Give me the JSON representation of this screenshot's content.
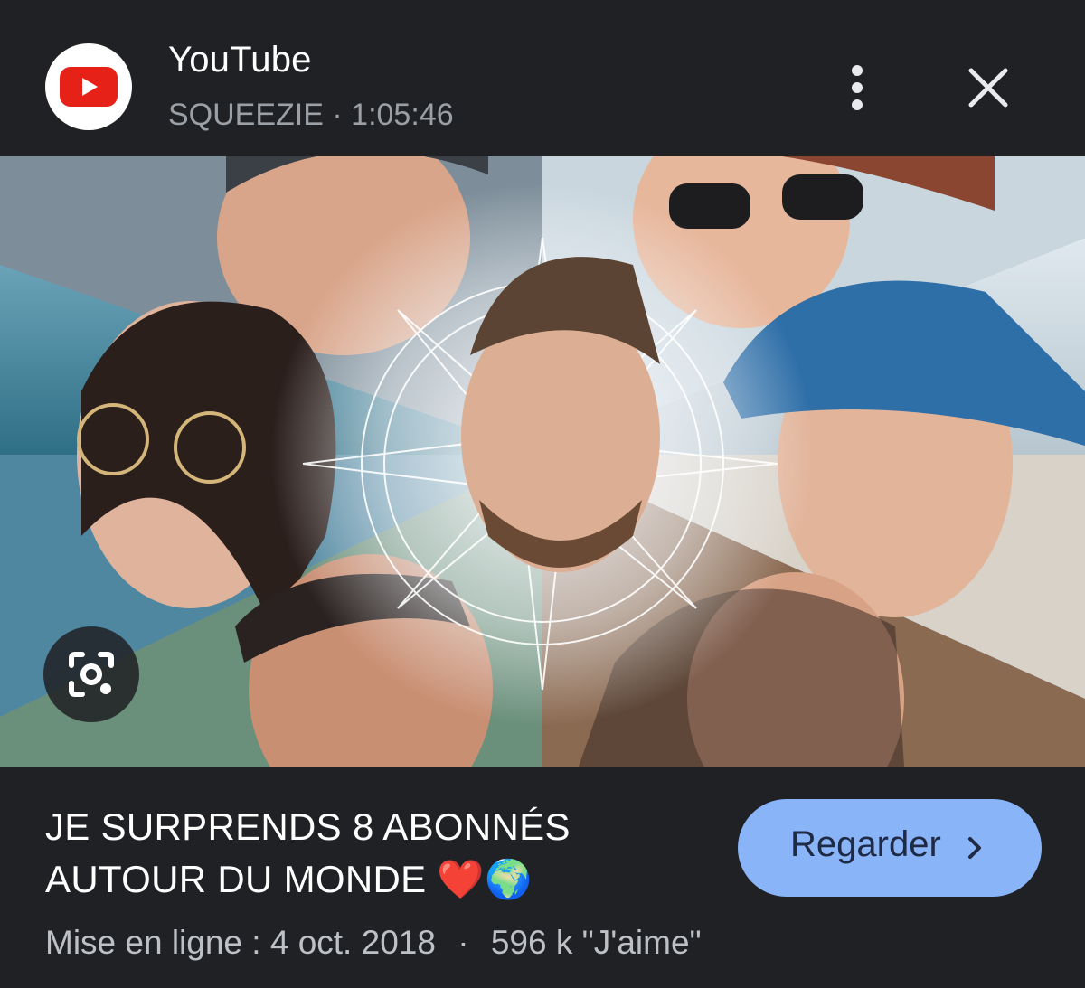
{
  "header": {
    "source_name": "YouTube",
    "channel": "SQUEEZIE",
    "separator": "·",
    "duration": "1:05:46",
    "logo_icon": "youtube-logo",
    "more_icon": "more-vert-icon",
    "close_icon": "close-icon"
  },
  "thumbnail": {
    "lens_icon": "google-lens-icon"
  },
  "video": {
    "title_line1": "JE SURPRENDS 8 ABONNÉS",
    "title_line2": "AUTOUR DU MONDE ❤️🌍",
    "upload_label": "Mise en ligne : 4 oct. 2018",
    "separator": "·",
    "likes": "596 k \"J'aime\""
  },
  "action": {
    "watch_label": "Regarder",
    "chevron_icon": "chevron-right-icon"
  },
  "colors": {
    "background": "#202124",
    "accent_button": "#8ab4f8",
    "youtube_red": "#ff0000"
  }
}
